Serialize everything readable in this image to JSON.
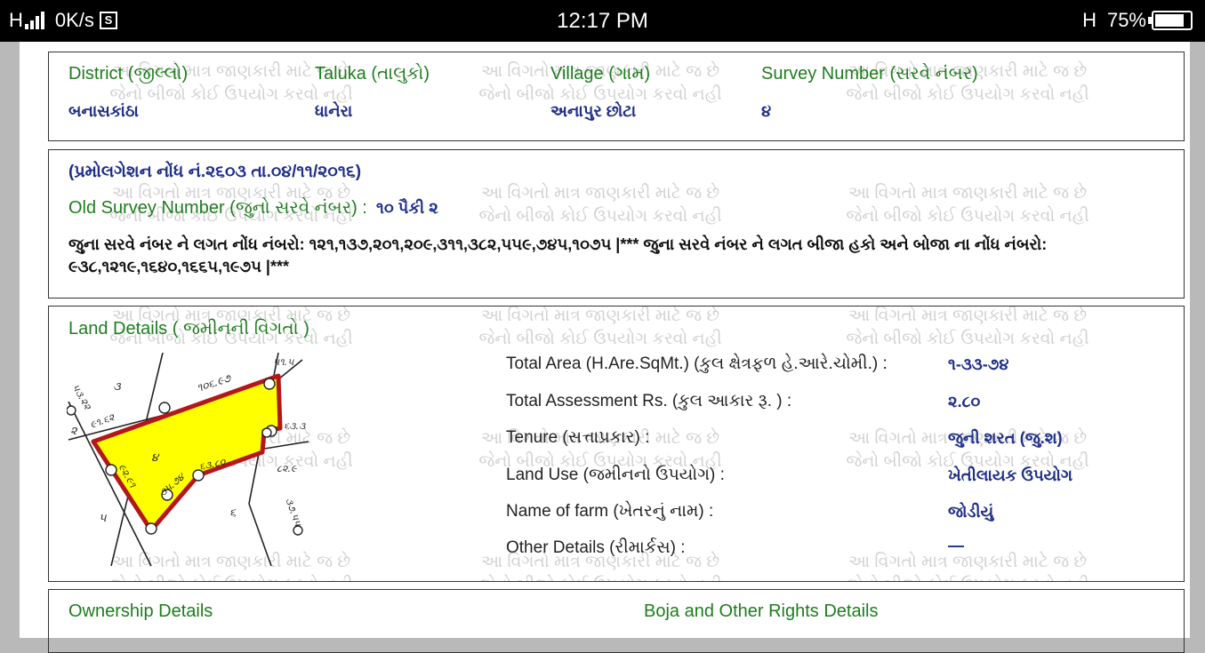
{
  "status_bar": {
    "network_left": "H",
    "speed": "0K/s",
    "time": "12:17 PM",
    "network_right": "H",
    "battery": "75%",
    "battery_level": 0.75
  },
  "watermark": {
    "line1": "આ વિગતો માત્ર જાણકારી માટે જ છે",
    "line2": "જેનો બીજો કોઈ ઉપયોગ કરવો નહી"
  },
  "location": {
    "district_label": "District (જીલ્લો)",
    "district_value": "બનાસકાંઠા",
    "taluka_label": "Taluka (તાલુકો)",
    "taluka_value": "ધાનેરા",
    "village_label": "Village (ગામ)",
    "village_value": "અનાપુર છોટા",
    "survey_label": "Survey Number (સરવે નંબર)",
    "survey_value": "૪"
  },
  "promulgation": {
    "heading": "(પ્રમોલગેશન નોંધ નં.૨૬૦૩ તા.૦૪/૧૧/૨૦૧૬)",
    "old_survey_label": "Old Survey Number (જુનો સરવે નંબર) :",
    "old_survey_value": "૧૦ પૈકી ૨",
    "entries_text": "જુના સરવે નંબર ને લગત નોંધ નંબરો: ૧૨૧,૧૩૭,૨૦૧,૨૦૯,૩૧૧,૩૮૨,૫૫૯,૭૪૫,૧૦૭૫ |*** જુના સરવે નંબર ને લગત બીજા હકો અને બોજા ના નોંધ નંબરો: ૯૩૮,૧૨૧૯,૧૬૪૦,૧૬૬૫,૧૯૭૫ |***"
  },
  "land_details": {
    "heading": "Land Details ( જમીનની વિગતો )",
    "rows": [
      {
        "label": "Total Area (H.Are.SqMt.) (કુલ ક્ષેત્રફળ હે.આરે.ચોમી.) :",
        "value": "૧-૩૩-૭૪"
      },
      {
        "label": "Total Assessment Rs. (કુલ આકાર રૂ. ) :",
        "value": "૨.૮૦"
      },
      {
        "label": "Tenure (સત્તાપ્રકાર) :",
        "value": "જુની શરત (જુ.શ)"
      },
      {
        "label": "Land Use (જમીનનો ઉપયોગ) :",
        "value": "ખેતીલાયક ઉપયોગ"
      },
      {
        "label": "Name of farm (ખેતરનું નામ) :",
        "value": "જોડીયું"
      },
      {
        "label": "Other Details (રીમાર્કસ) :",
        "value": "—"
      }
    ],
    "map_labels": [
      "૩",
      "૨",
      "૪",
      "૫",
      "૬",
      "૧૦૬.૯૭",
      "૯૧.૬૨",
      "૯૨.૯૧",
      "૩૫.૭૪",
      "૬૩.૮૦",
      "૮૨.૯",
      "૩૭.૫૫",
      "૫૧.૫",
      "૫૩.૨૨",
      "૬૩.૩"
    ]
  },
  "ownership": {
    "ownership_label": "Ownership Details",
    "boja_label": "Boja and Other Rights Details"
  },
  "colors": {
    "label_green": "#1e7d1e",
    "value_blue": "#1f2f8a",
    "plot_fill": "#ffff00",
    "plot_border": "#b3171b"
  }
}
